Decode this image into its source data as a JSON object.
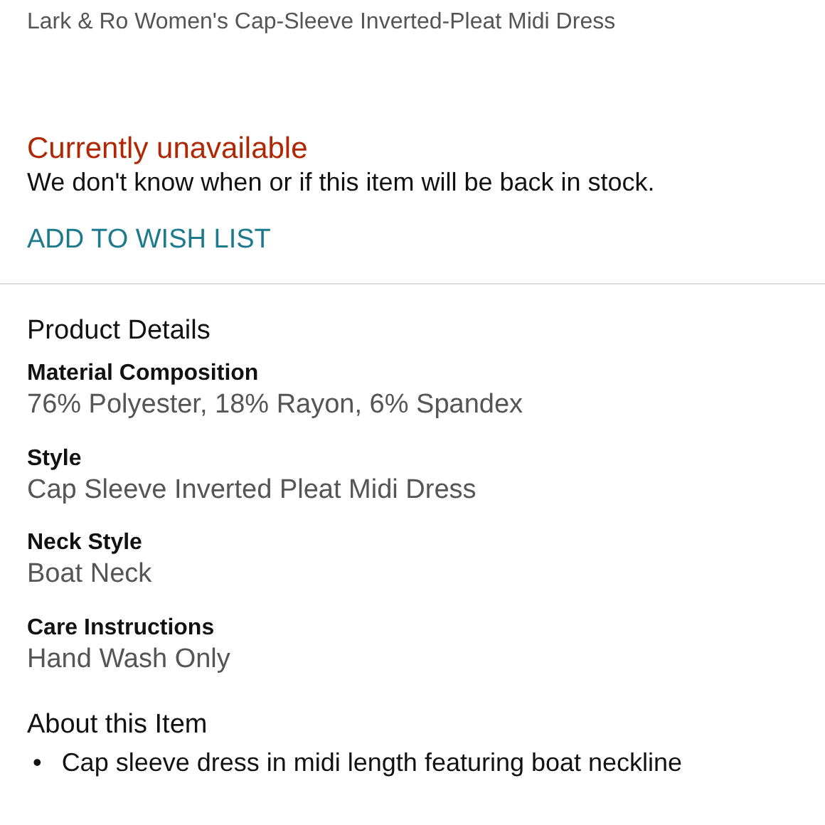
{
  "product_title": "Lark & Ro Women's Cap-Sleeve Inverted-Pleat Midi Dress",
  "availability": {
    "status": "Currently unavailable",
    "message": "We don't know when or if this item will be back in stock."
  },
  "wish_list_link": "ADD TO WISH LIST",
  "product_details": {
    "heading": "Product Details",
    "items": [
      {
        "label": "Material Composition",
        "value": "76% Polyester, 18% Rayon, 6% Spandex"
      },
      {
        "label": "Style",
        "value": "Cap Sleeve Inverted Pleat Midi Dress"
      },
      {
        "label": "Neck Style",
        "value": "Boat Neck"
      },
      {
        "label": "Care Instructions",
        "value": "Hand Wash Only"
      }
    ]
  },
  "about": {
    "heading": "About this Item",
    "bullets": [
      {
        "marker": "•",
        "text": "Cap sleeve dress in midi length featuring boat neckline"
      }
    ]
  }
}
